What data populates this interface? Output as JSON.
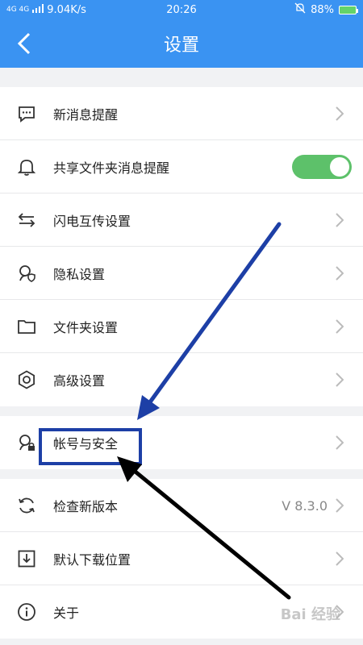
{
  "status_bar": {
    "network": "4G 4G",
    "speed": "9.04K/s",
    "time": "20:26",
    "battery": "88%"
  },
  "header": {
    "title": "设置"
  },
  "settings": {
    "items": [
      {
        "label": "新消息提醒",
        "icon": "chat-bubble-icon"
      },
      {
        "label": "共享文件夹消息提醒",
        "icon": "bell-icon",
        "toggle_on": true
      },
      {
        "label": "闪电互传设置",
        "icon": "transfer-arrows-icon"
      },
      {
        "label": "隐私设置",
        "icon": "privacy-shield-icon"
      },
      {
        "label": "文件夹设置",
        "icon": "folder-icon"
      },
      {
        "label": "高级设置",
        "icon": "gear-icon"
      },
      {
        "label": "帐号与安全",
        "icon": "account-lock-icon"
      },
      {
        "label": "检查新版本",
        "icon": "refresh-icon",
        "value": "V 8.3.0"
      },
      {
        "label": "默认下载位置",
        "icon": "download-icon"
      },
      {
        "label": "关于",
        "icon": "info-icon"
      }
    ]
  },
  "watermark": "Bai 经验",
  "colors": {
    "header": "#3a93f2",
    "toggle": "#5dc16a",
    "annotation_blue": "#1d3fa6",
    "annotation_black": "#000000"
  }
}
